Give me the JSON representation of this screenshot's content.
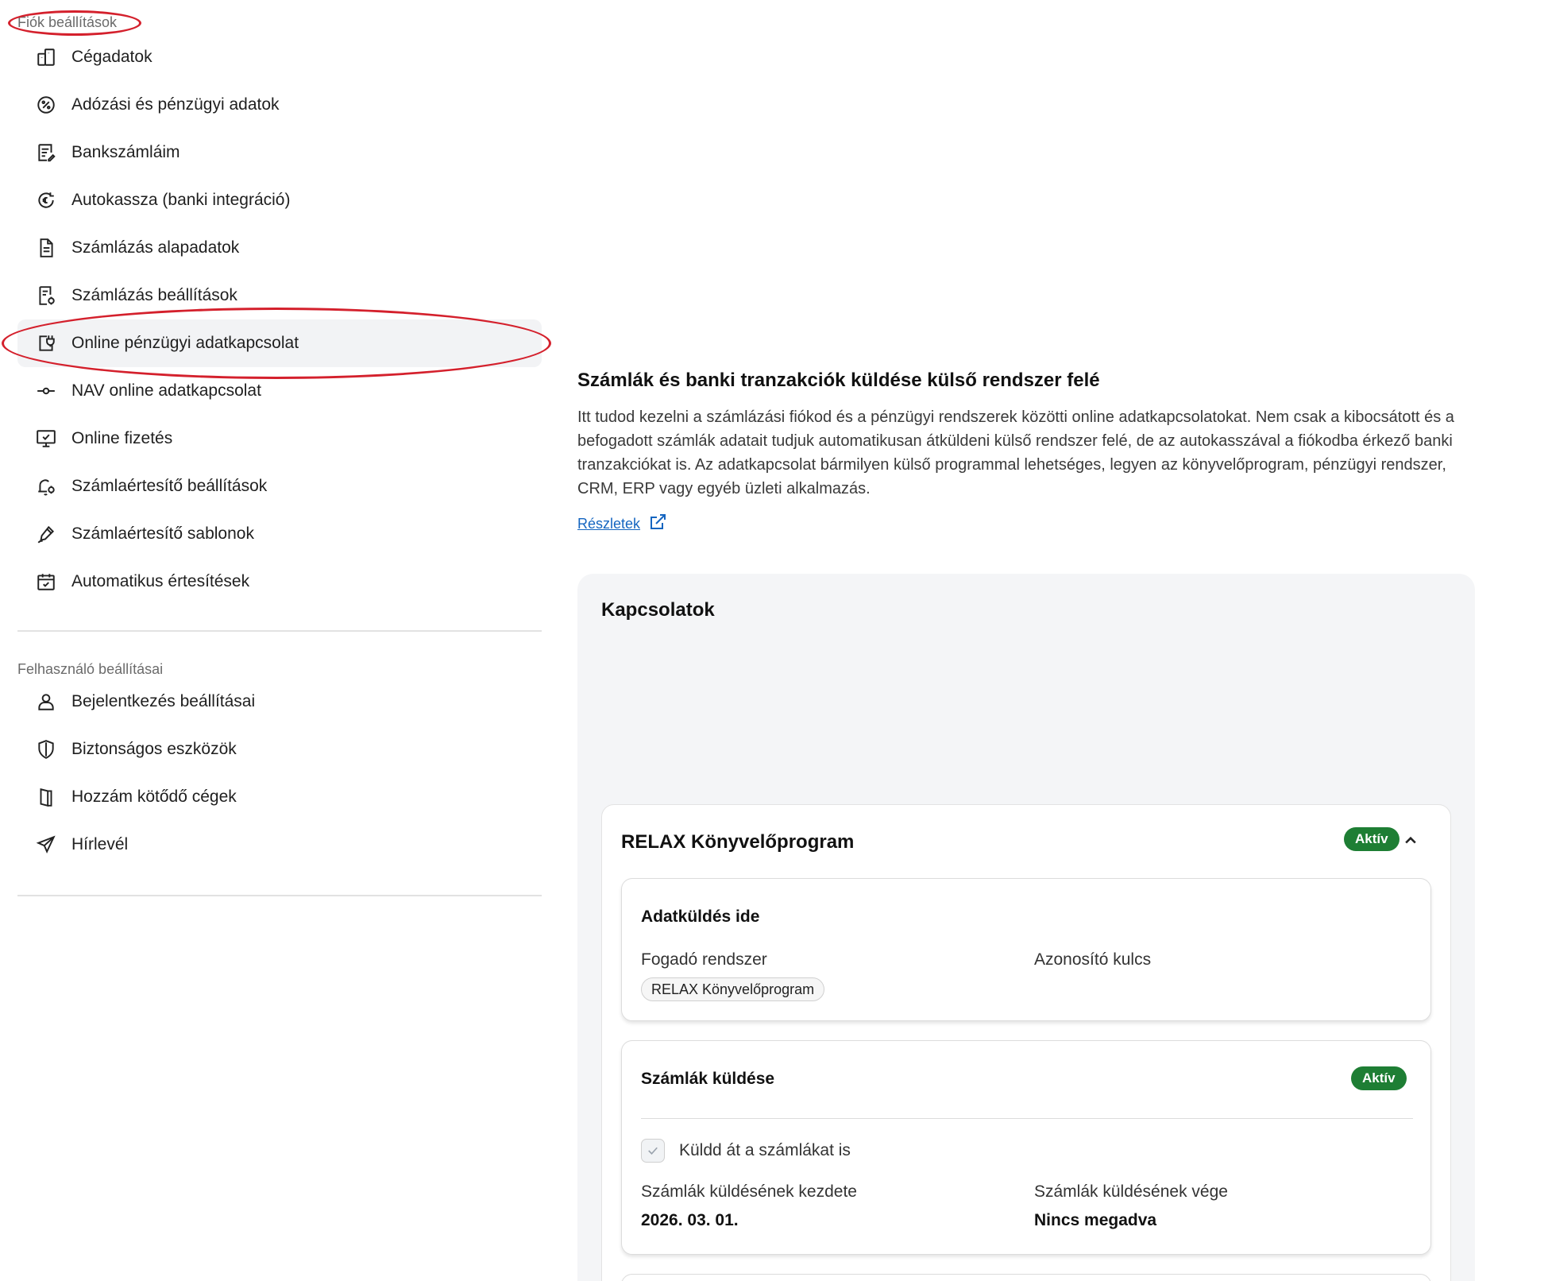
{
  "sidebar": {
    "account_section_label": "Fiók beállítások",
    "account_items": [
      {
        "label": "Cégadatok",
        "icon": "building-icon"
      },
      {
        "label": "Adózási és pénzügyi adatok",
        "icon": "percent-icon"
      },
      {
        "label": "Bankszámláim",
        "icon": "bank-account-icon"
      },
      {
        "label": "Autokassza (banki integráció)",
        "icon": "autocash-icon"
      },
      {
        "label": "Számlázás alapadatok",
        "icon": "document-icon"
      },
      {
        "label": "Számlázás beállítások",
        "icon": "invoice-settings-icon"
      },
      {
        "label": "Online pénzügyi adatkapcsolat",
        "icon": "plug-icon"
      },
      {
        "label": "NAV online adatkapcsolat",
        "icon": "connection-icon"
      },
      {
        "label": "Online fizetés",
        "icon": "monitor-payment-icon"
      },
      {
        "label": "Számlaértesítő beállítások",
        "icon": "notification-settings-icon"
      },
      {
        "label": "Számlaértesítő sablonok",
        "icon": "template-pen-icon"
      },
      {
        "label": "Automatikus értesítések",
        "icon": "calendar-check-icon"
      }
    ],
    "active_index": 6,
    "user_section_label": "Felhasználó beállításai",
    "user_items": [
      {
        "label": "Bejelentkezés beállításai",
        "icon": "user-icon"
      },
      {
        "label": "Biztonságos eszközök",
        "icon": "shield-icon"
      },
      {
        "label": "Hozzám kötődő cégek",
        "icon": "companies-icon"
      },
      {
        "label": "Hírlevél",
        "icon": "send-icon"
      }
    ]
  },
  "main": {
    "title": "Számlák és banki tranzakciók küldése külső rendszer felé",
    "description": "Itt tudod kezelni a számlázási fiókod és a pénzügyi rendszerek közötti online adatkapcsolatokat. Nem csak a kibocsátott és a befogadott számlák adatait tudjuk automatikusan átküldeni külső rendszer felé, de az autokasszával a fiókodba érkező banki tranzakciókat is. Az adatkapcsolat bármilyen külső programmal lehetséges, legyen az könyvelőprogram, pénzügyi rendszer, CRM, ERP vagy egyéb üzleti alkalmazás.",
    "details_link": "Részletek",
    "connections_title": "Kapcsolatok",
    "connection": {
      "name": "RELAX Könyvelőprogram",
      "status": "Aktív",
      "data_target": {
        "title": "Adatküldés ide",
        "receiver_label": "Fogadó rendszer",
        "receiver_value": "RELAX Könyvelőprogram",
        "key_label": "Azonosító kulcs"
      },
      "invoices": {
        "title": "Számlák küldése",
        "status": "Aktív",
        "checkbox_label": "Küldd át a számlákat is",
        "checked": true,
        "start_label": "Számlák küldésének kezdete",
        "start_value": "2026. 03. 01.",
        "end_label": "Számlák küldésének vége",
        "end_value": "Nincs megadva"
      }
    }
  },
  "colors": {
    "accent_link": "#1565c0",
    "badge_green": "#1e7e34",
    "annotation_red": "#d4202c",
    "active_bg": "#f2f3f5"
  }
}
